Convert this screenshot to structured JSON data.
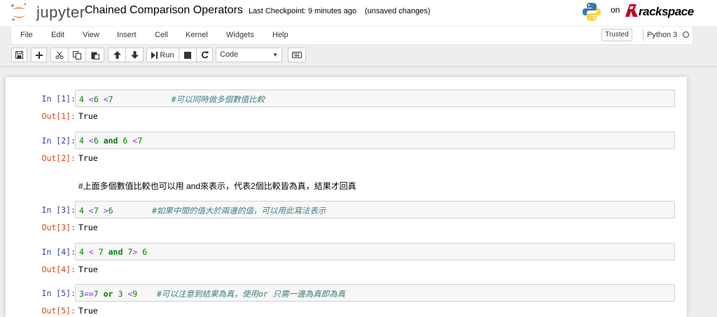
{
  "header": {
    "logo_text": "jupyter",
    "notebook_title": "Chained Comparison Operators",
    "checkpoint": "Last Checkpoint: 9 minutes ago",
    "unsaved": "(unsaved changes)",
    "on_text": "on",
    "rackspace_text": "rackspace"
  },
  "menu": {
    "items": [
      "File",
      "Edit",
      "View",
      "Insert",
      "Cell",
      "Kernel",
      "Widgets",
      "Help"
    ],
    "trusted": "Trusted",
    "kernel": "Python 3"
  },
  "toolbar": {
    "run_label": "Run",
    "cell_type": "Code",
    "icons": [
      "save-icon",
      "add-icon",
      "cut-icon",
      "copy-icon",
      "paste-icon",
      "move-up-icon",
      "move-down-icon",
      "run-icon",
      "stop-icon",
      "restart-icon",
      "keyboard-icon"
    ]
  },
  "cells": [
    {
      "in_prompt": "In [1]:",
      "out_prompt": "Out[1]:",
      "output": "True",
      "code": [
        [
          "num",
          "4"
        ],
        [
          "plain",
          " "
        ],
        [
          "op",
          "<"
        ],
        [
          "num",
          "6"
        ],
        [
          "plain",
          " "
        ],
        [
          "op",
          "<"
        ],
        [
          "num",
          "7"
        ],
        [
          "plain",
          "            "
        ],
        [
          "cm",
          "#可以同時做多個數值比較"
        ]
      ]
    },
    {
      "in_prompt": "In [2]:",
      "out_prompt": "Out[2]:",
      "output": "True",
      "code": [
        [
          "num",
          "4"
        ],
        [
          "plain",
          " "
        ],
        [
          "op",
          "<"
        ],
        [
          "num",
          "6"
        ],
        [
          "plain",
          " "
        ],
        [
          "kw",
          "and"
        ],
        [
          "plain",
          " "
        ],
        [
          "num",
          "6"
        ],
        [
          "plain",
          " "
        ],
        [
          "op",
          "<"
        ],
        [
          "num",
          "7"
        ]
      ]
    },
    {
      "in_prompt": "In [3]:",
      "out_prompt": "Out[3]:",
      "output": "True",
      "code": [
        [
          "num",
          "4"
        ],
        [
          "plain",
          " "
        ],
        [
          "op",
          "<"
        ],
        [
          "num",
          "7"
        ],
        [
          "plain",
          " "
        ],
        [
          "op",
          ">"
        ],
        [
          "num",
          "6"
        ],
        [
          "plain",
          "        "
        ],
        [
          "cm",
          "#如果中間的值大於兩邊的值，可以用此寫法表示"
        ]
      ]
    },
    {
      "in_prompt": "In [4]:",
      "out_prompt": "Out[4]:",
      "output": "True",
      "code": [
        [
          "num",
          "4"
        ],
        [
          "plain",
          " "
        ],
        [
          "op",
          "<"
        ],
        [
          "plain",
          " "
        ],
        [
          "num",
          "7"
        ],
        [
          "plain",
          " "
        ],
        [
          "kw",
          "and"
        ],
        [
          "plain",
          " "
        ],
        [
          "num",
          "7"
        ],
        [
          "op",
          ">"
        ],
        [
          "plain",
          " "
        ],
        [
          "num",
          "6"
        ]
      ]
    },
    {
      "in_prompt": "In [5]:",
      "out_prompt": "Out[5]:",
      "output": "True",
      "code": [
        [
          "num",
          "3"
        ],
        [
          "op",
          "=="
        ],
        [
          "num",
          "7"
        ],
        [
          "plain",
          " "
        ],
        [
          "kw",
          "or"
        ],
        [
          "plain",
          " "
        ],
        [
          "num",
          "3"
        ],
        [
          "plain",
          " "
        ],
        [
          "op",
          "<"
        ],
        [
          "num",
          "9"
        ],
        [
          "plain",
          "    "
        ],
        [
          "cm",
          "#可以注意到結果為真，使用or 只需一邊為真即為真"
        ]
      ]
    }
  ],
  "markdown": "#上面多個數值比較也可以用 and來表示，代表2個比較皆為真，結果才回真",
  "colors": {
    "in_prompt": "#303f9f",
    "out_prompt": "#d84315",
    "number": "#008800",
    "operator": "#aa22ff",
    "keyword": "#008000",
    "comment": "#408080"
  }
}
